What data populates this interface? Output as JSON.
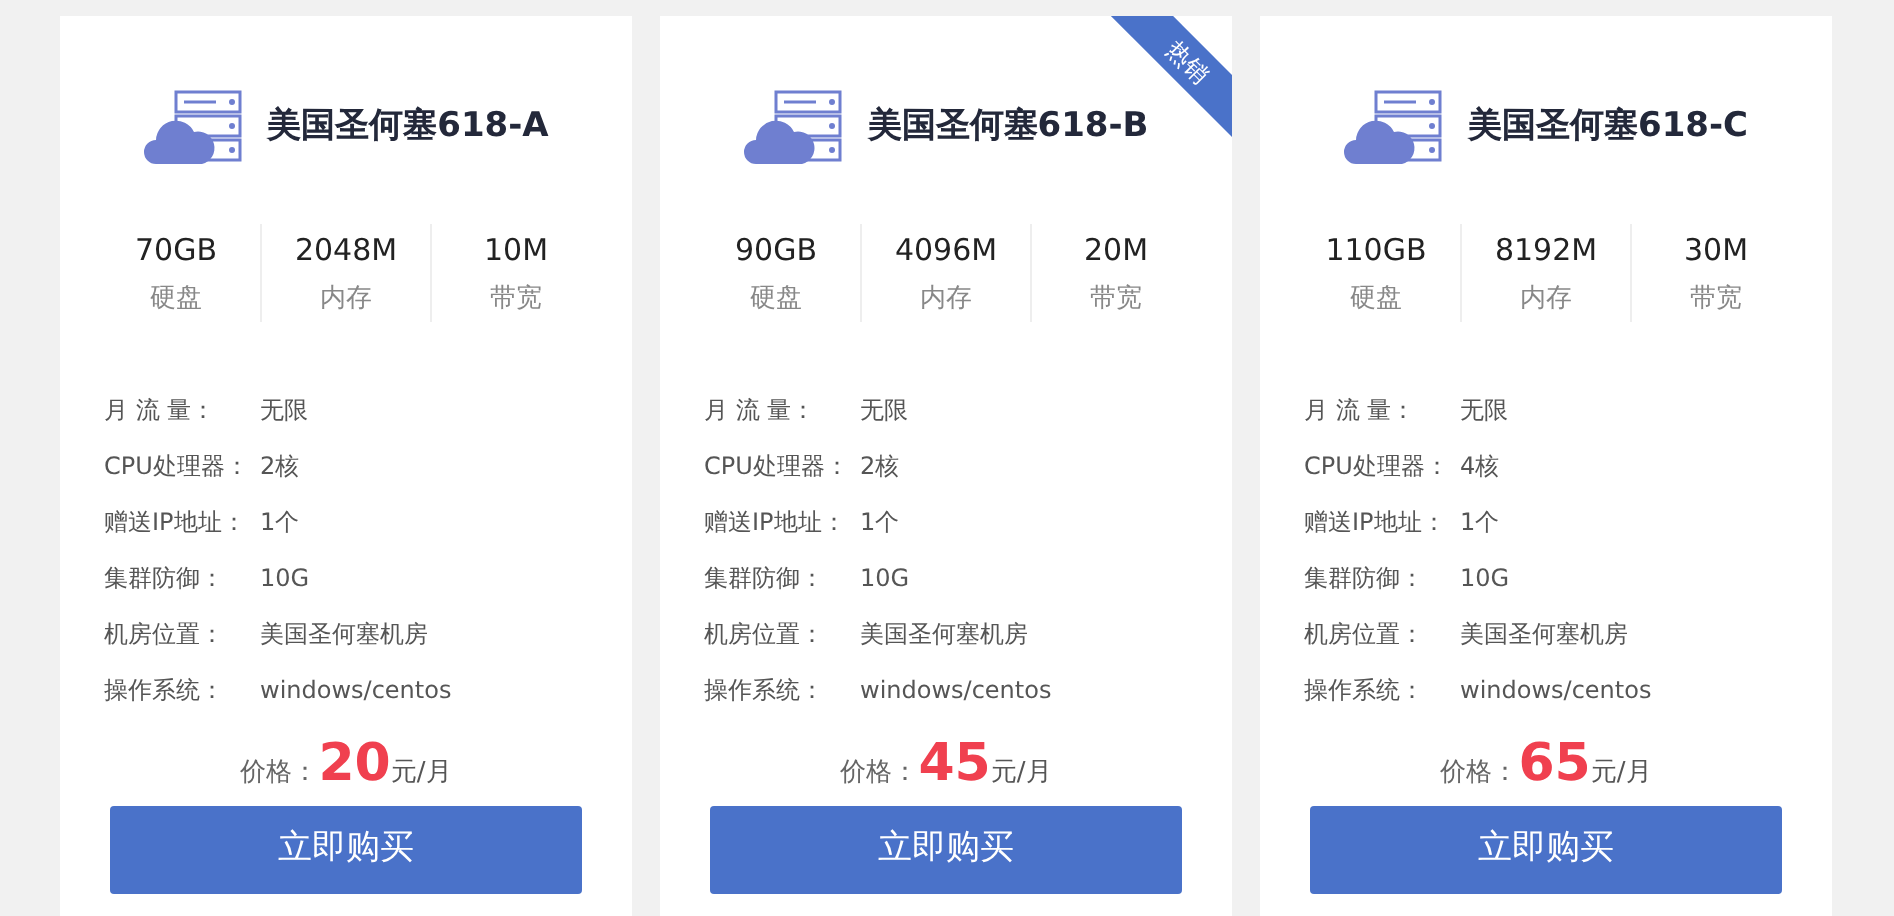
{
  "plans": [
    {
      "name": "美国圣何塞618-A",
      "hot": false,
      "specs": [
        {
          "value": "70GB",
          "label": "硬盘"
        },
        {
          "value": "2048M",
          "label": "内存"
        },
        {
          "value": "10M",
          "label": "带宽"
        }
      ],
      "details": [
        {
          "label": "月 流 量：",
          "value": "无限"
        },
        {
          "label": "CPU处理器：",
          "value": "2核"
        },
        {
          "label": "赠送IP地址：",
          "value": "1个"
        },
        {
          "label": "集群防御：",
          "value": "10G"
        },
        {
          "label": "机房位置：",
          "value": "美国圣何塞机房"
        },
        {
          "label": "操作系统：",
          "value": "windows/centos"
        }
      ],
      "price_label": "价格：",
      "price": "20",
      "price_unit": "元/月",
      "button": "立即购买"
    },
    {
      "name": "美国圣何塞618-B",
      "hot": true,
      "badge": "热销",
      "specs": [
        {
          "value": "90GB",
          "label": "硬盘"
        },
        {
          "value": "4096M",
          "label": "内存"
        },
        {
          "value": "20M",
          "label": "带宽"
        }
      ],
      "details": [
        {
          "label": "月 流 量：",
          "value": "无限"
        },
        {
          "label": "CPU处理器：",
          "value": "2核"
        },
        {
          "label": "赠送IP地址：",
          "value": "1个"
        },
        {
          "label": "集群防御：",
          "value": "10G"
        },
        {
          "label": "机房位置：",
          "value": "美国圣何塞机房"
        },
        {
          "label": "操作系统：",
          "value": "windows/centos"
        }
      ],
      "price_label": "价格：",
      "price": "45",
      "price_unit": "元/月",
      "button": "立即购买"
    },
    {
      "name": "美国圣何塞618-C",
      "hot": false,
      "specs": [
        {
          "value": "110GB",
          "label": "硬盘"
        },
        {
          "value": "8192M",
          "label": "内存"
        },
        {
          "value": "30M",
          "label": "带宽"
        }
      ],
      "details": [
        {
          "label": "月 流 量：",
          "value": "无限"
        },
        {
          "label": "CPU处理器：",
          "value": "4核"
        },
        {
          "label": "赠送IP地址：",
          "value": "1个"
        },
        {
          "label": "集群防御：",
          "value": "10G"
        },
        {
          "label": "机房位置：",
          "value": "美国圣何塞机房"
        },
        {
          "label": "操作系统：",
          "value": "windows/centos"
        }
      ],
      "price_label": "价格：",
      "price": "65",
      "price_unit": "元/月",
      "button": "立即购买"
    }
  ]
}
